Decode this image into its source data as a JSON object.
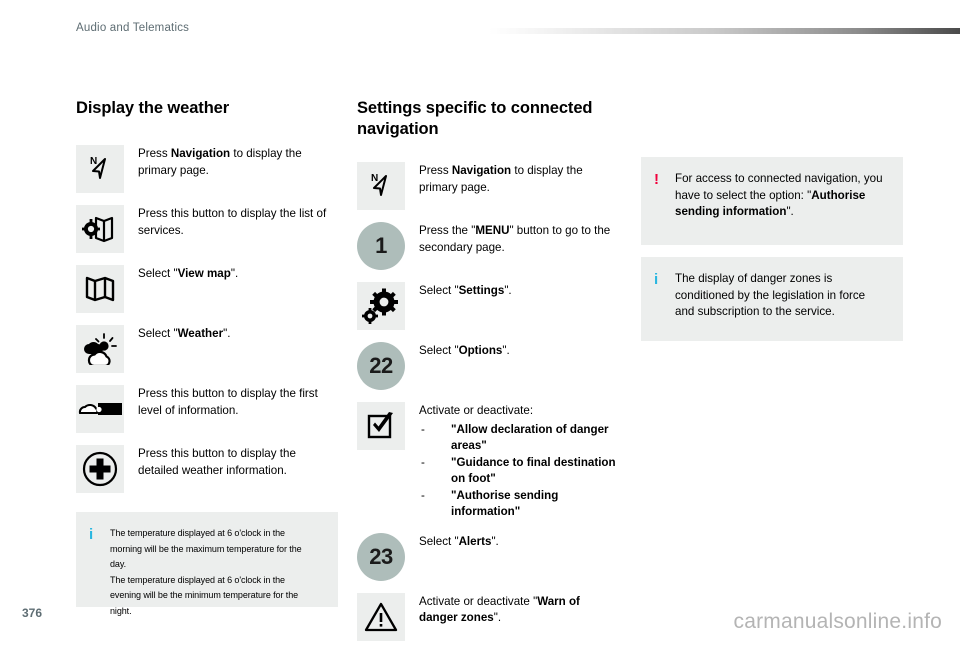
{
  "header": {
    "title": "Audio and Telematics"
  },
  "footer": {
    "page_number": "376",
    "watermark": "carmanualsonline.info"
  },
  "colors": {
    "accent_info": "#29b6e0",
    "accent_warning": "#f1003c",
    "badge_circle": "#aebdba",
    "tile_background": "#eceeed",
    "header_text": "#5e6d73"
  },
  "left_column": {
    "title": "Display the weather",
    "steps": [
      {
        "icon": "navigation-north-arrow-icon",
        "text_pre": "Press ",
        "text_bold": "Navigation",
        "text_post": " to display the primary page."
      },
      {
        "icon": "map-services-gear-icon",
        "text_pre": "Press this button to display the list of services.",
        "text_bold": "",
        "text_post": ""
      },
      {
        "icon": "folded-map-icon",
        "text_pre": "Select \"",
        "text_bold": "View map",
        "text_post": "\"."
      },
      {
        "icon": "weather-sun-cloud-icon",
        "text_pre": "Select \"",
        "text_bold": "Weather",
        "text_post": "\"."
      },
      {
        "icon": "weather-bar-first-level-icon",
        "text_pre": "Press this button to display the first level of information.",
        "text_bold": "",
        "text_post": ""
      },
      {
        "icon": "plus-circle-icon",
        "text_pre": "Press this button to display the detailed weather information.",
        "text_bold": "",
        "text_post": ""
      }
    ],
    "note": {
      "icon": "info-icon",
      "line1": "The temperature displayed at 6 o'clock in the morning will be the maximum temperature for the day.",
      "line2": "The temperature displayed at 6 o'clock in the evening will be the minimum temperature for the night."
    }
  },
  "middle_column": {
    "title": "Settings specific to connected navigation",
    "steps": [
      {
        "icon": "navigation-north-arrow-icon",
        "badge": "",
        "text_pre": "Press ",
        "text_bold": "Navigation",
        "text_post": " to display the primary page."
      },
      {
        "icon": "",
        "badge": "1",
        "text_pre": "Press the \"",
        "text_bold": "MENU",
        "text_post": "\" button to go to the secondary page."
      },
      {
        "icon": "settings-gears-icon",
        "badge": "",
        "text_pre": "Select \"",
        "text_bold": "Settings",
        "text_post": "\"."
      },
      {
        "icon": "",
        "badge": "22",
        "text_pre": "Select \"",
        "text_bold": "Options",
        "text_post": "\"."
      },
      {
        "icon": "checkbox-checked-icon",
        "badge": "",
        "text_pre": "Activate or deactivate:",
        "text_bold": "",
        "text_post": "",
        "bullets": [
          "\"Allow declaration of danger areas\"",
          "\"Guidance to final destination on foot\"",
          "\"Authorise sending information\""
        ]
      },
      {
        "icon": "",
        "badge": "23",
        "text_pre": "Select \"",
        "text_bold": "Alerts",
        "text_post": "\"."
      },
      {
        "icon": "warning-triangle-icon",
        "badge": "",
        "text_pre": "Activate or deactivate \"",
        "text_bold": "Warn of danger zones",
        "text_post": "\"."
      }
    ]
  },
  "right_column": {
    "notes": [
      {
        "icon": "warning-icon",
        "kind": "warn",
        "text_pre": "For access to connected navigation, you have to select the option: \"",
        "text_bold": "Authorise sending information",
        "text_post": "\"."
      },
      {
        "icon": "info-icon",
        "kind": "info",
        "text_pre": "The display of danger zones is conditioned by the legislation in force and subscription to the service.",
        "text_bold": "",
        "text_post": ""
      }
    ]
  }
}
